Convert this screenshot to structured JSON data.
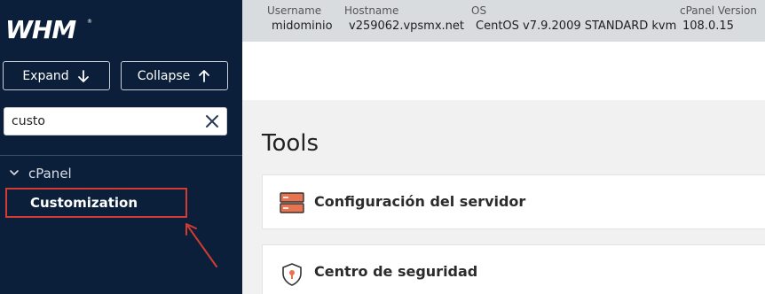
{
  "brand": {
    "logo_text": "WHM",
    "accent": "#d23b30",
    "sidebar_bg": "#0b1f3a"
  },
  "sidebar": {
    "expand_label": "Expand",
    "collapse_label": "Collapse",
    "search": {
      "value": "custo",
      "placeholder": ""
    },
    "tree": {
      "parent_label": "cPanel",
      "child_label": "Customization"
    }
  },
  "topbar": {
    "username": {
      "label": "Username",
      "value": "midominio"
    },
    "hostname": {
      "label": "Hostname",
      "value": "v259062.vpsmx.net"
    },
    "os": {
      "label": "OS",
      "value": "CentOS v7.9.2009 STANDARD kvm"
    },
    "cpanel_version": {
      "label": "cPanel Version",
      "value": "108.0.15"
    }
  },
  "main": {
    "title": "Tools",
    "cards": [
      {
        "label": "Configuración del servidor",
        "icon": "server-icon"
      },
      {
        "label": "Centro de seguridad",
        "icon": "security-shield-icon"
      }
    ]
  }
}
